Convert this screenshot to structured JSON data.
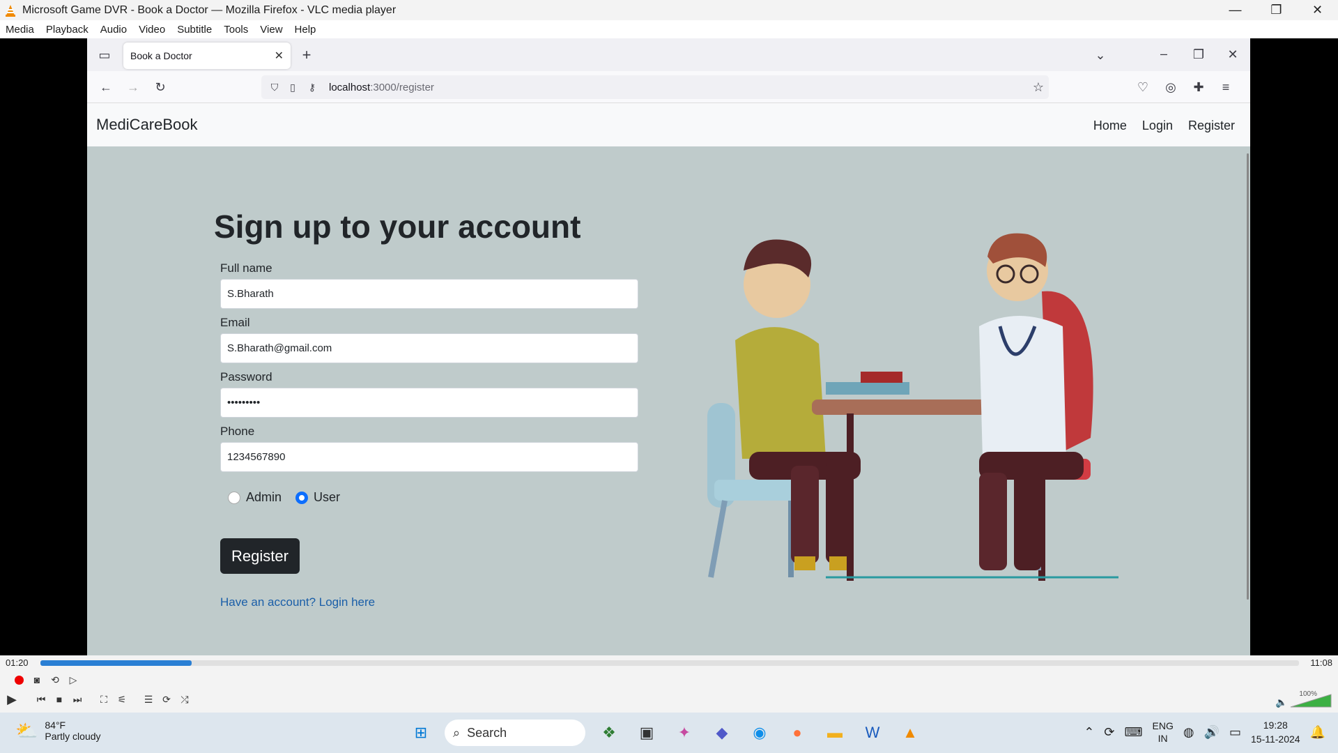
{
  "vlc": {
    "title": "Microsoft Game DVR - Book a Doctor — Mozilla Firefox - VLC media player",
    "menu": [
      "Media",
      "Playback",
      "Audio",
      "Video",
      "Subtitle",
      "Tools",
      "View",
      "Help"
    ],
    "time_elapsed": "01:20",
    "time_total": "11:08",
    "progress_fraction": 0.12,
    "volume": "100%"
  },
  "browser": {
    "tab_label": "Book a Doctor",
    "url_host": "localhost",
    "url_path": ":3000/register"
  },
  "site": {
    "brand": "MediCareBook",
    "nav": [
      "Home",
      "Login",
      "Register"
    ],
    "heading": "Sign up to your account",
    "fields": {
      "fullname_label": "Full name",
      "fullname_value": "S.Bharath",
      "email_label": "Email",
      "email_value": "S.Bharath@gmail.com",
      "password_label": "Password",
      "password_value": "•••••••••",
      "phone_label": "Phone",
      "phone_value": "1234567890"
    },
    "roles": {
      "admin": "Admin",
      "user": "User",
      "selected": "User"
    },
    "submit_label": "Register",
    "login_link": "Have an account? Login here"
  },
  "taskbar": {
    "temp": "84°F",
    "weather": "Partly cloudy",
    "search_label": "Search",
    "lang_line1": "ENG",
    "lang_line2": "IN",
    "time": "19:28",
    "date": "15-11-2024"
  },
  "colors": {
    "page_bg": "#bfcbcb",
    "accent_blue": "#0d6efd",
    "button_dark": "#212529"
  }
}
